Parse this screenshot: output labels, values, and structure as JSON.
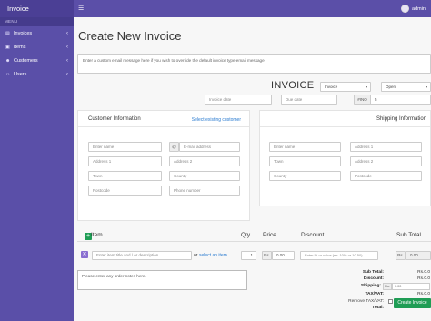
{
  "brand": "Invoice",
  "user": {
    "name": "admin"
  },
  "sidebar": {
    "header": "MENU",
    "items": [
      {
        "icon": "file-icon",
        "label": "Invoices",
        "chevron": "‹"
      },
      {
        "icon": "box-icon",
        "label": "Items",
        "chevron": "‹"
      },
      {
        "icon": "users-icon",
        "label": "Customers",
        "chevron": "‹"
      },
      {
        "icon": "user-icon",
        "label": "Users",
        "chevron": "‹"
      }
    ]
  },
  "page": {
    "title": "Create New Invoice",
    "email_message_placeholder": "Enter a custom email message here if you wish to override the default invoice type email message"
  },
  "invoice": {
    "heading": "INVOICE",
    "type_selected": "Invoice",
    "status_selected": "Open",
    "invoice_date_placeholder": "Invoice date",
    "due_date_placeholder": "Due date",
    "number_prefix": "#INO",
    "number_value": "5"
  },
  "customer": {
    "title": "Customer Information",
    "select_existing": "Select existing customer",
    "name_placeholder": "Enter name",
    "email_addon": "@",
    "email_placeholder": "E-mail address",
    "address1_placeholder": "Address 1",
    "address2_placeholder": "Address 2",
    "town_placeholder": "Town",
    "county_placeholder": "County",
    "postcode_placeholder": "Postcode",
    "phone_placeholder": "Phone number"
  },
  "shipping": {
    "title": "Shipping Information",
    "name_placeholder": "Enter name",
    "address1_placeholder": "Address 1",
    "address2_placeholder": "Address 2",
    "town_placeholder": "Town",
    "county_placeholder": "County",
    "postcode_placeholder": "Postcode"
  },
  "items_table": {
    "headers": {
      "item": "Item",
      "qty": "Qty",
      "price": "Price",
      "discount": "Discount",
      "subtotal": "Sub Total"
    },
    "add_icon": "plus-icon",
    "delete_icon": "x-icon",
    "row": {
      "item_placeholder": "Enter item title and / or description",
      "or_text": "or",
      "select_item": "select an item",
      "qty_value": "1",
      "currency_addon": "Rs.",
      "price_value": "0.00",
      "discount_placeholder": "Enter % or value (ex: 10% or 10.50)",
      "subtotal_value": "0.00"
    }
  },
  "notes": {
    "placeholder": "Please enter any order notes here."
  },
  "totals": {
    "subtotal_label": "Sub Total:",
    "subtotal_value": "Rs.0.0",
    "discount_label": "Discount:",
    "discount_value": "Rs.0.0",
    "shipping_label": "Shipping:",
    "shipping_addon": "Rs.",
    "shipping_value": "0.00",
    "tax_label": "TAX/VAT:",
    "tax_value": "Rs.0.0",
    "remove_tax_label": "Remove TAX/VAT:",
    "total_label": "Total:",
    "total_value": "Rs.0.0"
  },
  "actions": {
    "create": "Create Invoice"
  },
  "colors": {
    "sidebar": "#5a4fa8",
    "accent_green": "#1f9d55",
    "link": "#2a7bd0"
  }
}
